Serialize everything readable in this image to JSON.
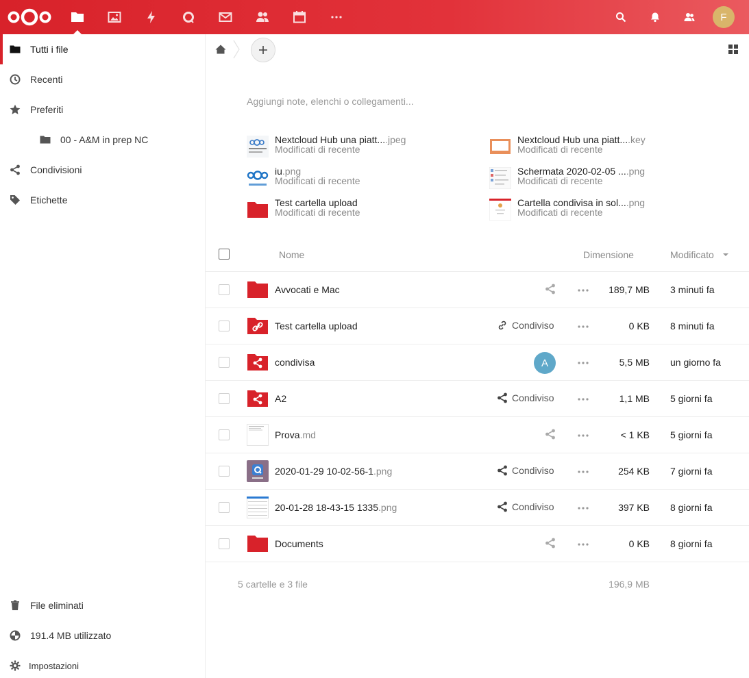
{
  "header": {
    "apps": [
      {
        "name": "files-icon",
        "active": true
      },
      {
        "name": "photos-icon"
      },
      {
        "name": "activity-icon"
      },
      {
        "name": "talk-icon"
      },
      {
        "name": "mail-icon"
      },
      {
        "name": "contacts-icon"
      },
      {
        "name": "calendar-icon"
      },
      {
        "name": "more-apps-icon"
      }
    ],
    "avatar_initial": "F",
    "avatar_color": "#d9b56a",
    "brand_color": "#d8222a"
  },
  "sidebar": {
    "items": [
      {
        "label": "Tutti i file",
        "icon": "folder-icon"
      },
      {
        "label": "Recenti",
        "icon": "clock-icon"
      },
      {
        "label": "Preferiti",
        "icon": "star-icon"
      },
      {
        "label": "00 - A&M in prep NC",
        "icon": "folder-icon"
      },
      {
        "label": "Condivisioni",
        "icon": "share-icon"
      },
      {
        "label": "Etichette",
        "icon": "tag-icon"
      }
    ],
    "bottom": [
      {
        "label": "File eliminati",
        "icon": "trash-icon"
      },
      {
        "label": "191.4 MB utilizzato",
        "icon": "quota-icon"
      },
      {
        "label": "Impostazioni",
        "icon": "gear-icon"
      }
    ]
  },
  "main": {
    "notes_placeholder": "Aggiungi note, elenchi o collegamenti...",
    "recent": [
      {
        "name": "Nextcloud Hub una piatt...",
        "ext": ".jpeg",
        "sub": "Modificati di recente"
      },
      {
        "name": "Nextcloud Hub una piatt...",
        "ext": ".key",
        "sub": "Modificati di recente"
      },
      {
        "name": "iu",
        "ext": ".png",
        "sub": "Modificati di recente"
      },
      {
        "name": "Schermata 2020-02-05 ...",
        "ext": ".png",
        "sub": "Modificati di recente"
      },
      {
        "name": "Test cartella upload",
        "ext": "",
        "sub": "Modificati di recente"
      },
      {
        "name": "Cartella condivisa in sol...",
        "ext": ".png",
        "sub": "Modificati di recente"
      }
    ],
    "table": {
      "headers": {
        "name": "Nome",
        "size": "Dimensione",
        "modified": "Modificato"
      },
      "rows": [
        {
          "name": "Avvocati e Mac",
          "ext": "",
          "share_label": "",
          "size": "189,7 MB",
          "modified": "3 minuti fa"
        },
        {
          "name": "Test cartella upload",
          "ext": "",
          "share_label": "Condiviso",
          "size": "0 KB",
          "modified": "8 minuti fa"
        },
        {
          "name": "condivisa",
          "ext": "",
          "share_label": "",
          "share_avatar": "A",
          "size": "5,5 MB",
          "modified": "un giorno fa"
        },
        {
          "name": "A2",
          "ext": "",
          "share_label": "Condiviso",
          "size": "1,1 MB",
          "modified": "5 giorni fa"
        },
        {
          "name": "Prova",
          "ext": ".md",
          "share_label": "",
          "size": "< 1 KB",
          "modified": "5 giorni fa"
        },
        {
          "name": "2020-01-29 10-02-56-1",
          "ext": ".png",
          "share_label": "Condiviso",
          "size": "254 KB",
          "modified": "7 giorni fa"
        },
        {
          "name": "20-01-28 18-43-15 1335",
          "ext": ".png",
          "share_label": "Condiviso",
          "size": "397 KB",
          "modified": "8 giorni fa"
        },
        {
          "name": "Documents",
          "ext": "",
          "share_label": "",
          "size": "0 KB",
          "modified": "8 giorni fa"
        }
      ],
      "summary_count": "5 cartelle e 3 file",
      "summary_size": "196,9 MB"
    }
  }
}
